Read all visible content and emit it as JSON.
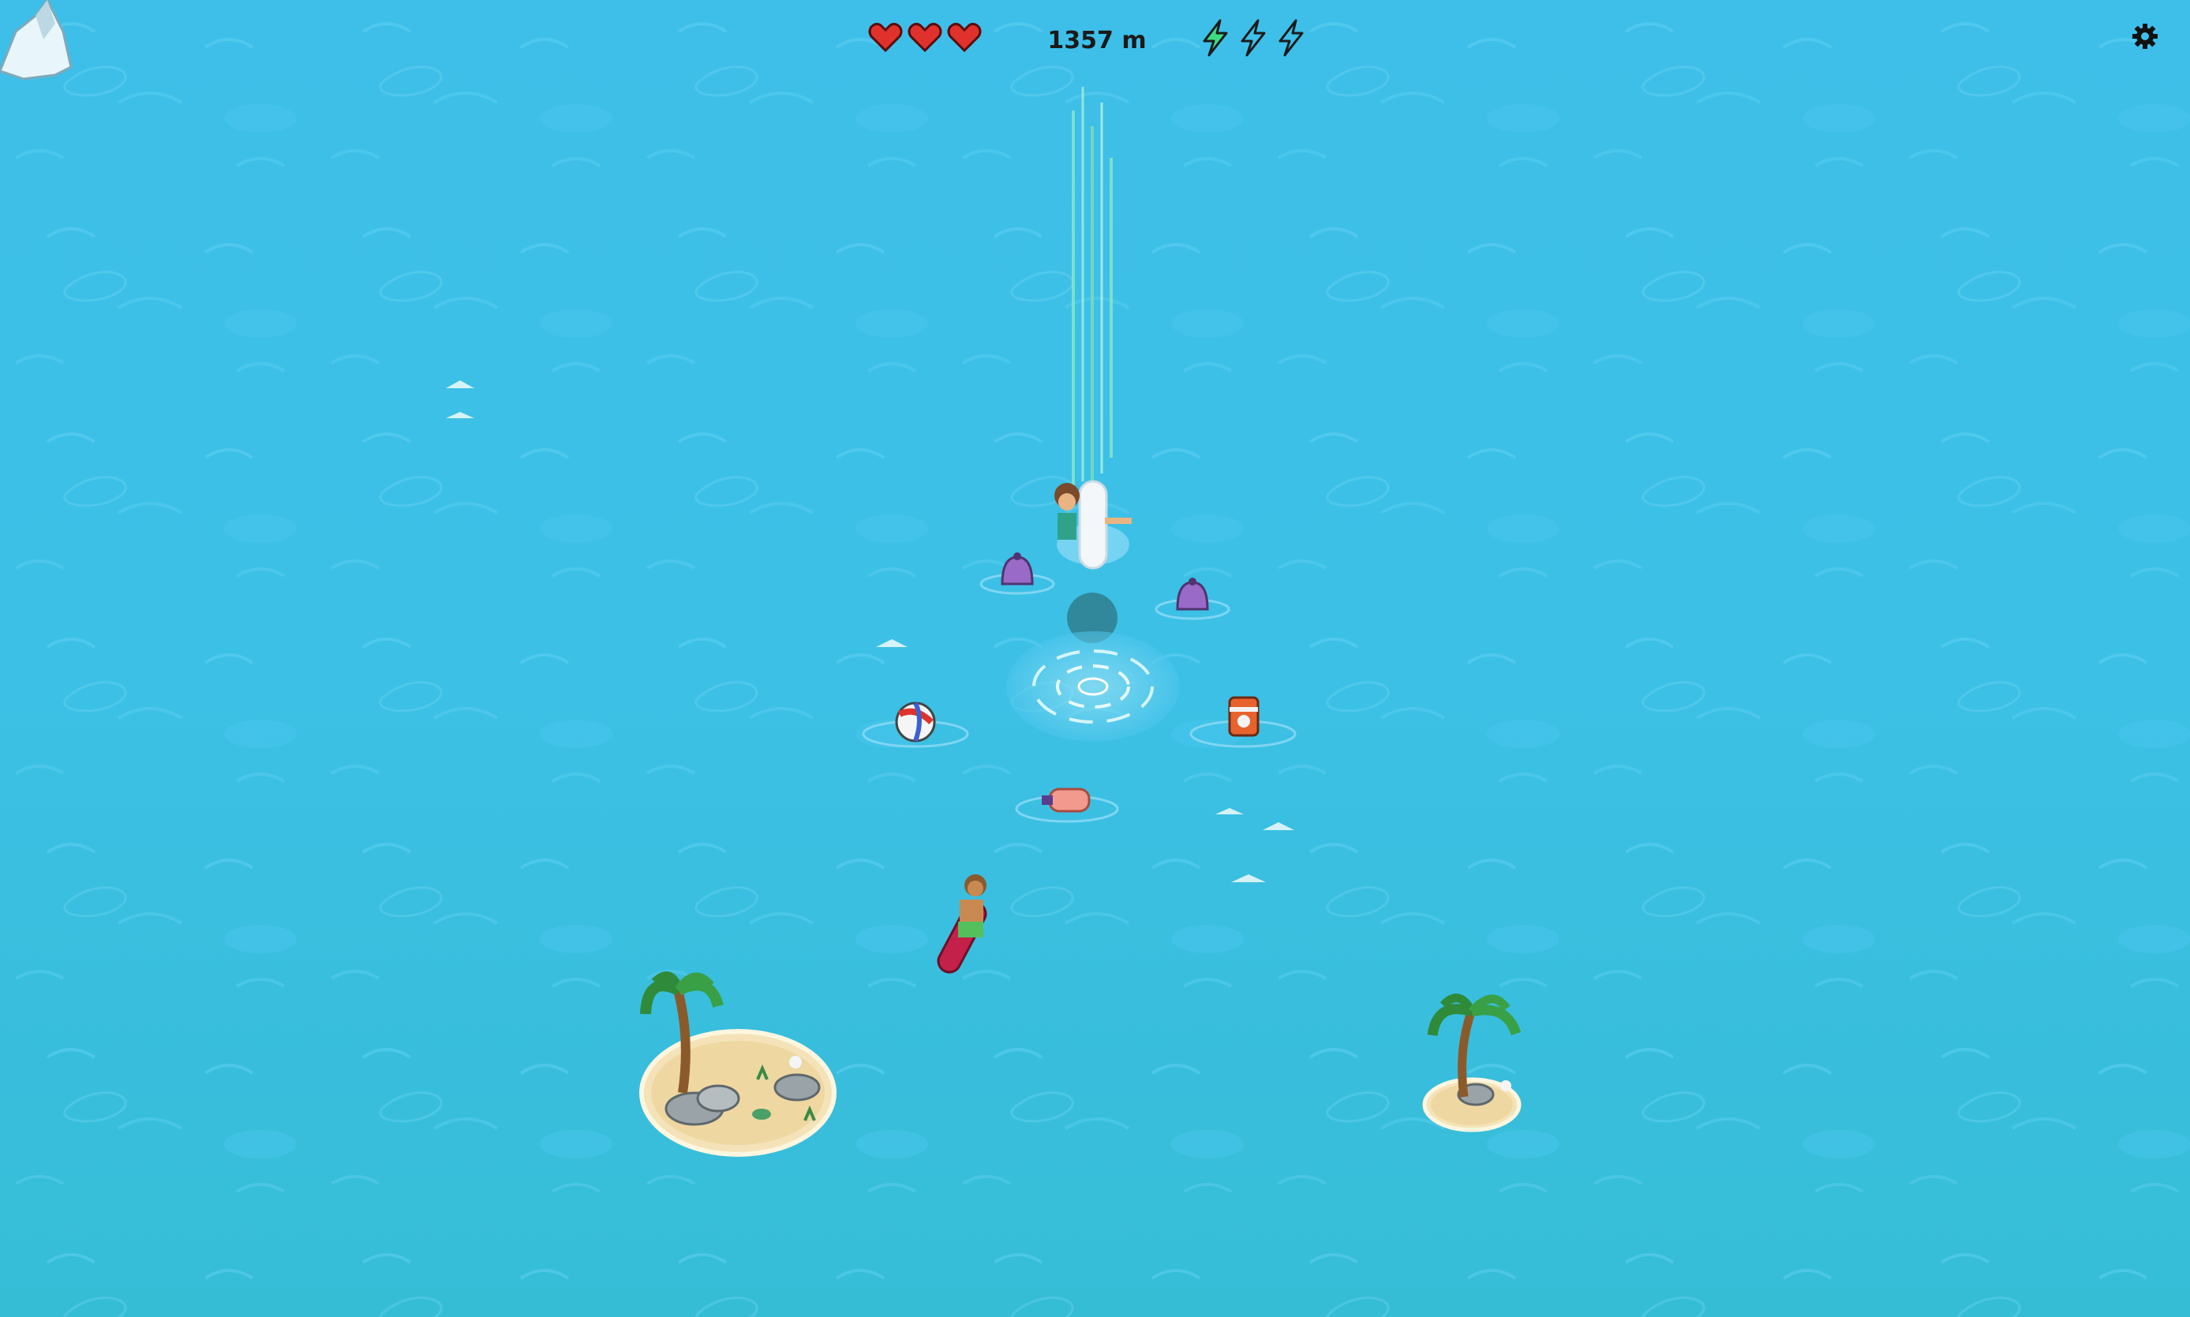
{
  "hud": {
    "lives": 3,
    "distance": "1357 m",
    "boosts_total": 3,
    "boosts_charged": 1,
    "settings_icon": "gear-icon"
  },
  "colors": {
    "sea": "#3ebfe9",
    "heart": "#e0322c",
    "boost_charged": "#3ddc84",
    "boost_empty": "#3ebfe9"
  },
  "sprites": {
    "player": "surfer-player",
    "chaser": "surfer-on-board-chaser",
    "obstacles": [
      "buoy-icon",
      "buoy-icon",
      "beach-ball-icon",
      "barrel-icon",
      "bottle-icon",
      "whirlpool-icon",
      "palm-island-icon",
      "palm-island-icon",
      "iceberg-icon"
    ]
  }
}
